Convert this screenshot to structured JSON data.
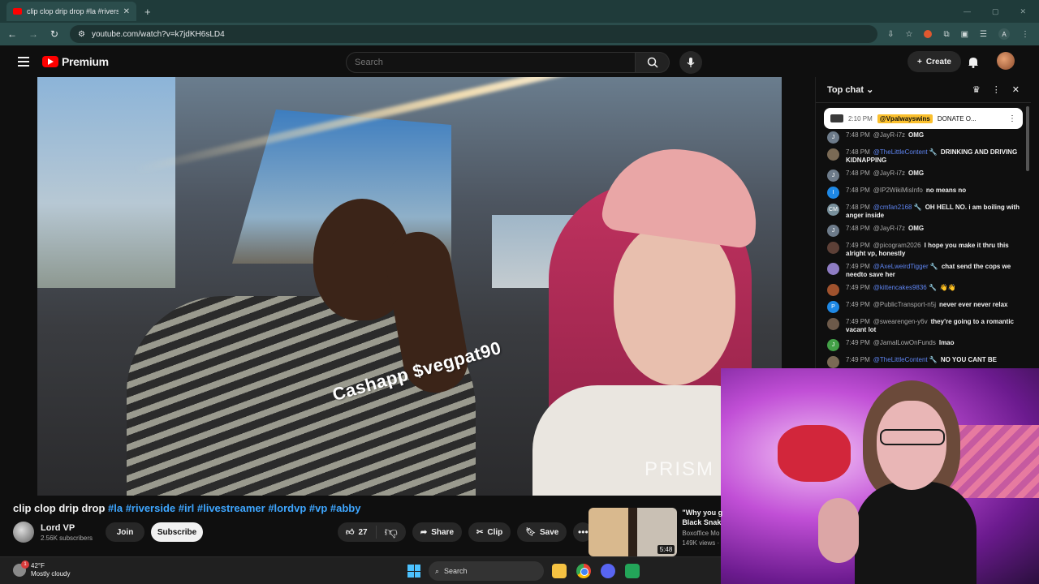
{
  "browser": {
    "tab_title": "clip clop drip drop #la #riverside",
    "tab_close": "✕",
    "new_tab": "+",
    "url": "youtube.com/watch?v=k7jdKH6sLD4",
    "profile_initial": "A"
  },
  "yt_header": {
    "logo_text": "Premium",
    "search_placeholder": "Search",
    "create_label": "Create"
  },
  "video": {
    "overlay_text": "Cashapp $vegpat90",
    "watermark": "PRISM"
  },
  "chat": {
    "header": "Top chat",
    "pinned": {
      "time": "2:10 PM",
      "user": "@Vpalwayswins",
      "text": "DONATE O..."
    },
    "messages": [
      {
        "time": "7:48 PM",
        "user": "@JayR-i7z",
        "text": "OMG",
        "avatar": "J",
        "color": "#6d7b8a",
        "mod": false
      },
      {
        "time": "7:48 PM",
        "user": "@TheLittleContent 🔧",
        "text": "DRINKING AND DRIVING KIDNAPPING",
        "avatar": "",
        "color": "#7a6a55",
        "mod": true
      },
      {
        "time": "7:48 PM",
        "user": "@JayR-i7z",
        "text": "OMG",
        "avatar": "J",
        "color": "#6d7b8a",
        "mod": false
      },
      {
        "time": "7:48 PM",
        "user": "@IP2WikiMisInfo",
        "text": "no means no",
        "avatar": "I",
        "color": "#1e88e5",
        "mod": false
      },
      {
        "time": "7:48 PM",
        "user": "@cmfan2168 🔧",
        "text": "OH HELL NO. i am boiling with anger inside",
        "avatar": "CM",
        "color": "#78909c",
        "mod": true
      },
      {
        "time": "7:48 PM",
        "user": "@JayR-i7z",
        "text": "OMG",
        "avatar": "J",
        "color": "#6d7b8a",
        "mod": false
      },
      {
        "time": "7:49 PM",
        "user": "@picogram2026",
        "text": "I hope you make it thru this alright vp, honestly",
        "avatar": "",
        "color": "#5d4037",
        "mod": false
      },
      {
        "time": "7:49 PM",
        "user": "@AxeLweirdTigger 🔧",
        "text": "chat send the cops we needto save her",
        "avatar": "",
        "color": "#8e7cc3",
        "mod": true
      },
      {
        "time": "7:49 PM",
        "user": "@kittencakes9836 🔧",
        "text": "👋👋",
        "avatar": "",
        "color": "#a0522d",
        "mod": true
      },
      {
        "time": "7:49 PM",
        "user": "@PublicTransport-n5j",
        "text": "never ever never relax",
        "avatar": "P",
        "color": "#1e88e5",
        "mod": false
      },
      {
        "time": "7:49 PM",
        "user": "@swearengen-y6v",
        "text": "they're going to a romantic vacant lot",
        "avatar": "",
        "color": "#6d5a4a",
        "mod": false
      },
      {
        "time": "7:49 PM",
        "user": "@JamalLowOnFunds",
        "text": "lmao",
        "avatar": "J",
        "color": "#43a047",
        "mod": false
      },
      {
        "time": "7:49 PM",
        "user": "@TheLittleContent 🔧",
        "text": "NO YOU CANT BE",
        "avatar": "",
        "color": "#7a6a55",
        "mod": true
      }
    ]
  },
  "video_info": {
    "title": "clip clop drip drop",
    "tags": "#la #riverside #irl #livestreamer #lordvp #vp #abby",
    "channel_name": "Lord VP",
    "subscribers": "2.56K subscribers",
    "join_label": "Join",
    "subscribe_label": "Subscribe",
    "like_count": "27",
    "share_label": "Share",
    "clip_label": "Clip",
    "save_label": "Save",
    "more": "•••"
  },
  "suggested": {
    "title_line1": "\"Why you g",
    "title_line2": "Black Snak",
    "channel": "Boxoffice Mo",
    "views": "149K views ·",
    "duration": "5:48"
  },
  "taskbar": {
    "temperature": "42°F",
    "condition": "Mostly cloudy",
    "badge": "1",
    "search_label": "Search"
  }
}
